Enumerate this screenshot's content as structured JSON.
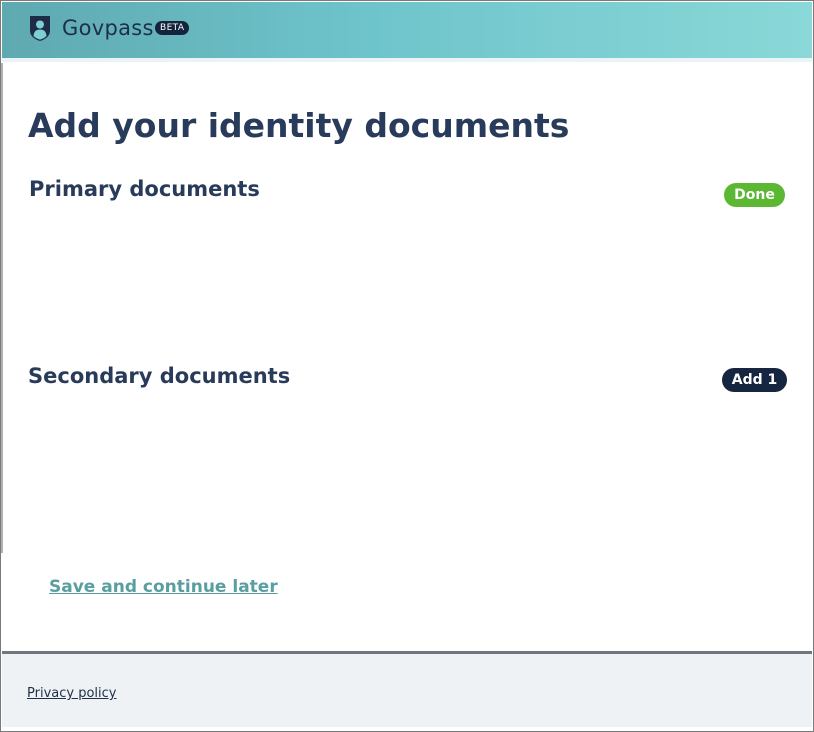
{
  "header": {
    "logo_icon": "shield-person-icon",
    "brand_name": "Govpass",
    "badge": "BETA",
    "gradient_colors": [
      "#5fa9b1",
      "#8ad8d8"
    ]
  },
  "main": {
    "title": "Add your identity documents",
    "sections": [
      {
        "heading": "Primary documents",
        "status_label": "Done",
        "status_color": "#5cb832"
      },
      {
        "heading": "Secondary documents",
        "status_label": "Add 1",
        "status_color": "#172640"
      }
    ],
    "save_link": "Save and continue later"
  },
  "footer": {
    "privacy_link": "Privacy policy"
  },
  "colors": {
    "heading": "#293b5a",
    "link_accent": "#5a9ea0",
    "footer_bg": "#eff2f5"
  }
}
